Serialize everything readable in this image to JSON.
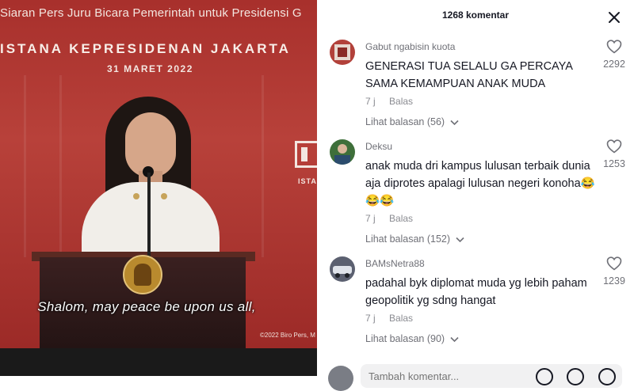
{
  "video": {
    "banner_top": "Siaran Pers Juru Bicara Pemerintah untuk Presidensi G",
    "banner_place": "ISTANA KEPRESIDENAN JAKARTA",
    "banner_date": "31 MARET 2022",
    "side_text": "ISTA",
    "subtitle": "Shalom, may peace be upon us all,",
    "copyright": "©2022 Biro Pers, M"
  },
  "comments_panel": {
    "header": "1268 komentar",
    "comments": [
      {
        "username": "Gabut ngabisin kuota",
        "text": "GENERASI TUA SELALU GA PERCAYA SAMA KEMAMPUAN ANAK MUDA",
        "time": "7 j",
        "reply_label": "Balas",
        "view_replies": "Lihat balasan (56)",
        "likes": "2292",
        "avatar_color": "#b2413a"
      },
      {
        "username": "Deksu",
        "text": "anak muda dri kampus lulusan terbaik dunia aja diprotes apalagi lulusan negeri konoha😂😂😂",
        "time": "7 j",
        "reply_label": "Balas",
        "view_replies": "Lihat balasan (152)",
        "likes": "1253",
        "avatar_color": "#3e6f3a"
      },
      {
        "username": "BAMsNetra88",
        "text": "padahal byk diplomat muda yg lebih paham geopolitik yg sdng hangat",
        "time": "7 j",
        "reply_label": "Balas",
        "view_replies": "Lihat balasan (90)",
        "likes": "1239",
        "avatar_color": "#5b6070"
      }
    ],
    "input_placeholder": "Tambah komentar..."
  }
}
